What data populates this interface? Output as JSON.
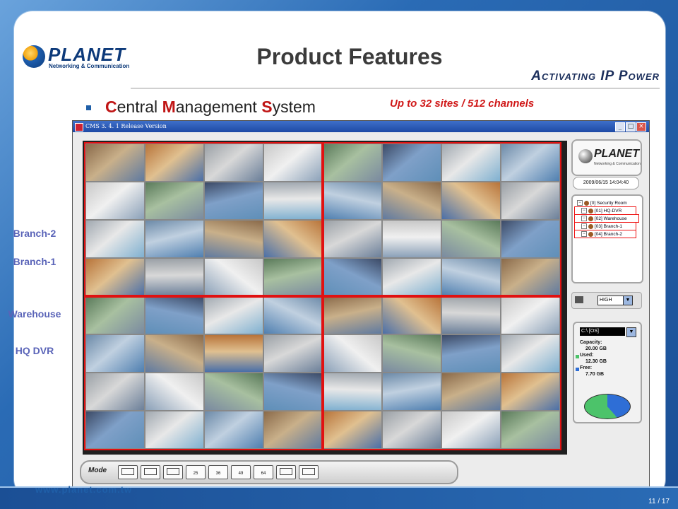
{
  "slide": {
    "title": "Product Features",
    "tagline": "Activating IP Power",
    "logo": {
      "word": "PLANET",
      "tag": "Networking & Communication"
    },
    "bullet": {
      "c": "C",
      "c_rest": "entral ",
      "m": "M",
      "m_rest": "anagement ",
      "s": "S",
      "s_rest": "ystem"
    },
    "subnote": "Up to 32 sites / 512 channels",
    "side_labels": [
      "Branch-2",
      "Branch-1",
      "Warehouse",
      "HQ DVR"
    ],
    "footer_url": "www.planet.com.tw",
    "page_number": "11 / 17"
  },
  "cms": {
    "window_title": "CMS 3. 4. 1 Release Version",
    "window_buttons": [
      "_",
      "□",
      "×"
    ],
    "panel_logo": {
      "word": "PLANET",
      "tag": "Networking & Communication"
    },
    "clock": "2009/06/15 14:04:40",
    "tree": [
      {
        "label": "[0] Security Room",
        "kind": "root"
      },
      {
        "label": "[01] HQ-DVR",
        "kind": "site"
      },
      {
        "label": "[02] Warehouse",
        "kind": "site"
      },
      {
        "label": "[03] Branch-1",
        "kind": "site"
      },
      {
        "label": "[04] Branch-2",
        "kind": "site"
      }
    ],
    "quality_value": "HIGH",
    "disk": {
      "drive": "C:\\ [OS]",
      "capacity_label": "Capacity:",
      "capacity_value": "20.00 GB",
      "used_label": "Used:",
      "used_value": "12.30 GB",
      "free_label": "Free:",
      "free_value": "7.70 GB",
      "used_fraction": 0.615
    },
    "mode_label": "Mode",
    "mode_buttons": [
      "",
      "",
      "",
      "25",
      "36",
      "49",
      "64",
      "",
      ""
    ],
    "colors": {
      "site_highlight": "#e11111",
      "used_color": "#4cc36a",
      "free_color": "#2e6ed6"
    }
  }
}
